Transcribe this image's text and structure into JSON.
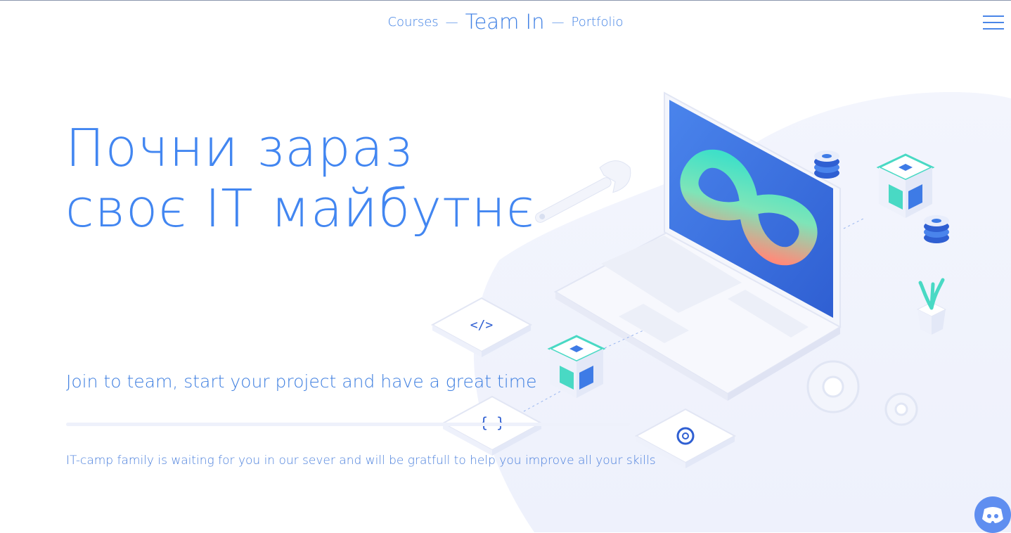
{
  "nav": {
    "courses_label": "Courses",
    "separator": "—",
    "brand_label": "Team In",
    "portfolio_label": "Portfolio"
  },
  "hero": {
    "title_line1": "Почни зараз",
    "title_line2": "своє IT майбутнє",
    "subtitle": "Join to team, start your project and have a great time",
    "description": "IT-camp family is waiting for you in our sever and will be gratfull to help you improve all your skills"
  },
  "illustration": {
    "code_tag_label": "</>",
    "braces_label": "{ }"
  },
  "colors": {
    "accent": "#4286f1",
    "laptop_screen": "#3e70e0",
    "teal": "#49d9c4",
    "discord": "#5f8ef0"
  },
  "icons": {
    "menu": "hamburger-icon",
    "discord": "discord-icon"
  }
}
